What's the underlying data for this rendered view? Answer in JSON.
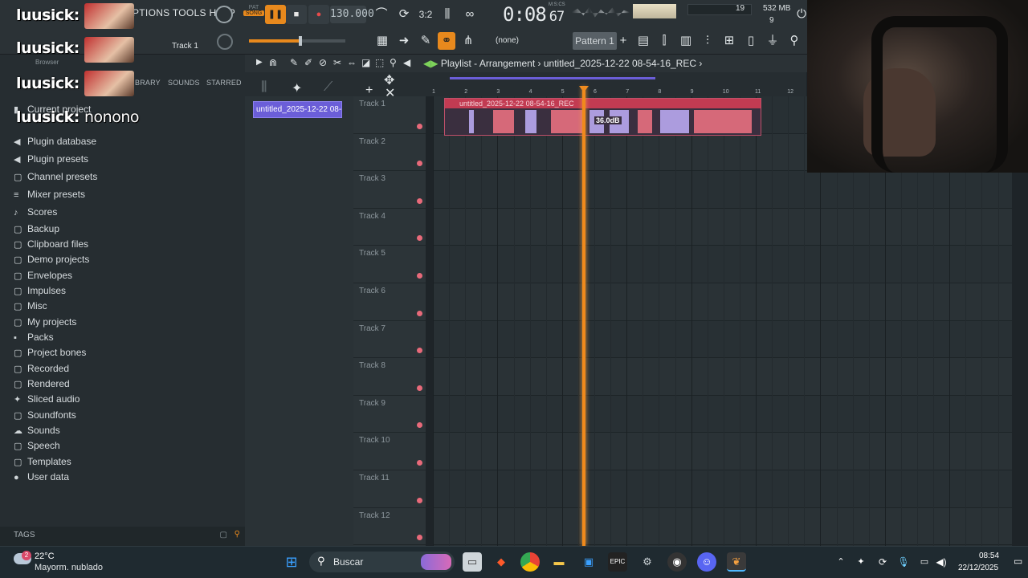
{
  "topbar": {
    "menu_text": "PTIONS TOOLS HELP",
    "pat_label": "PAT",
    "song_label": "SONG",
    "tempo": "130.000",
    "time_signature_label": "M:S:CS",
    "clock": "0:08",
    "clock_cs": "67",
    "pattern": "Pattern 1",
    "none_label": "(none)",
    "cpu_value": "19",
    "memory": "532 MB",
    "poly": "9",
    "track_label": "Track 1"
  },
  "browser": {
    "title": "Browser",
    "tabs": [
      "BRARY",
      "SOUNDS",
      "STARRED"
    ],
    "items": [
      {
        "icon": "file-icon",
        "glyph": "▮",
        "label": "Current project"
      },
      {
        "icon": "database-icon",
        "glyph": "◀",
        "label": "Plugin database"
      },
      {
        "icon": "preset-icon",
        "glyph": "◀",
        "label": "Plugin presets"
      },
      {
        "icon": "folder-icon",
        "glyph": "▢",
        "label": "Channel presets"
      },
      {
        "icon": "mixer-icon",
        "glyph": "≡",
        "label": "Mixer presets"
      },
      {
        "icon": "note-icon",
        "glyph": "♪",
        "label": "Scores"
      },
      {
        "icon": "folder-icon",
        "glyph": "▢",
        "label": "Backup"
      },
      {
        "icon": "folder-icon",
        "glyph": "▢",
        "label": "Clipboard files"
      },
      {
        "icon": "folder-icon",
        "glyph": "▢",
        "label": "Demo projects"
      },
      {
        "icon": "folder-icon",
        "glyph": "▢",
        "label": "Envelopes"
      },
      {
        "icon": "folder-icon",
        "glyph": "▢",
        "label": "Impulses"
      },
      {
        "icon": "folder-icon",
        "glyph": "▢",
        "label": "Misc"
      },
      {
        "icon": "folder-icon",
        "glyph": "▢",
        "label": "My projects"
      },
      {
        "icon": "packs-icon",
        "glyph": "▪",
        "label": "Packs"
      },
      {
        "icon": "folder-icon",
        "glyph": "▢",
        "label": "Project bones"
      },
      {
        "icon": "folder-icon",
        "glyph": "▢",
        "label": "Recorded"
      },
      {
        "icon": "folder-icon",
        "glyph": "▢",
        "label": "Rendered"
      },
      {
        "icon": "audio-icon",
        "glyph": "✦",
        "label": "Sliced audio"
      },
      {
        "icon": "folder-icon",
        "glyph": "▢",
        "label": "Soundfonts"
      },
      {
        "icon": "cloud-icon",
        "glyph": "☁",
        "label": "Sounds"
      },
      {
        "icon": "speech-icon",
        "glyph": "▢",
        "label": "Speech"
      },
      {
        "icon": "folder-icon",
        "glyph": "▢",
        "label": "Templates"
      },
      {
        "icon": "user-icon",
        "glyph": "●",
        "label": "User data"
      }
    ],
    "tags_label": "TAGS"
  },
  "overlay": {
    "username": "luusick:",
    "message": "nonono"
  },
  "playlist": {
    "title": "Playlist - Arrangement",
    "project": "untitled_2025-12-22 08-54-16_REC",
    "picker_clip": "untitled_2025-12-22 08-...",
    "clip_name": "untitled_2025-12-22 08-54-16_REC",
    "clip_gain": "36.0dB",
    "ruler": [
      "1",
      "2",
      "3",
      "4",
      "5",
      "6",
      "7",
      "8",
      "9",
      "10",
      "11",
      "12"
    ],
    "tracks": [
      "Track 1",
      "Track 2",
      "Track 3",
      "Track 4",
      "Track 5",
      "Track 6",
      "Track 7",
      "Track 8",
      "Track 9",
      "Track 10",
      "Track 11",
      "Track 12"
    ]
  },
  "taskbar": {
    "temperature": "22°C",
    "weather": "Mayorm. nublado",
    "weather_badge": "2",
    "search": "Buscar",
    "time": "08:54",
    "date": "22/12/2025"
  },
  "colors": {
    "accent_orange": "#f08a1c",
    "clip_red": "#c23b52",
    "selection_purple": "#6b5ed8"
  }
}
